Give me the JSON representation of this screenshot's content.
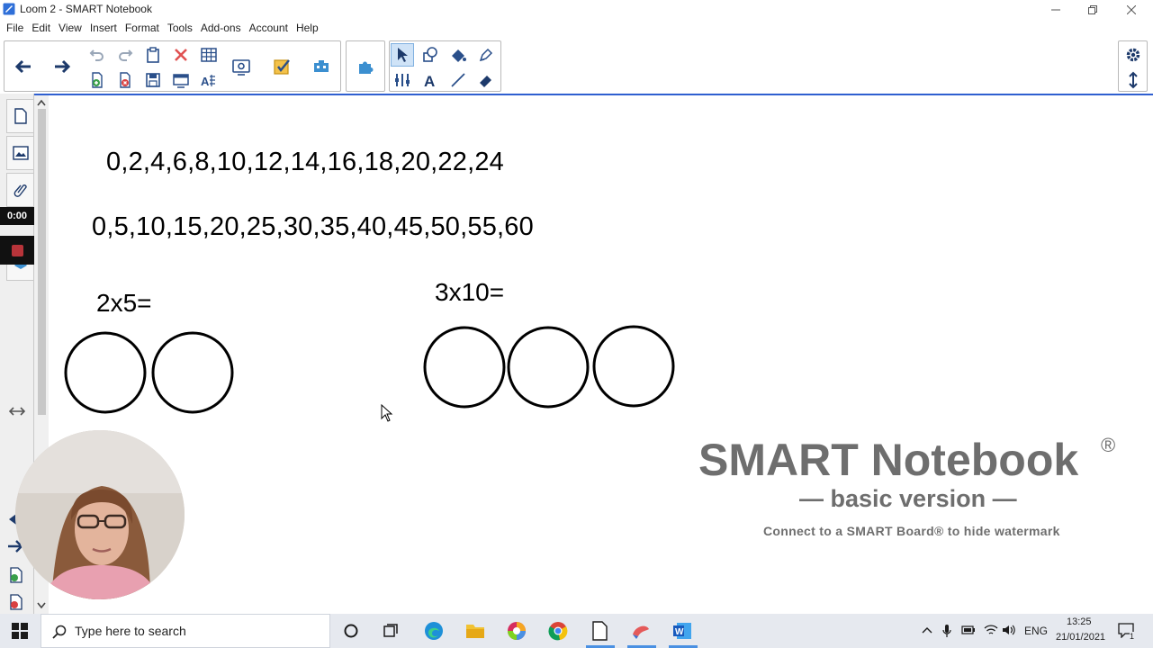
{
  "window": {
    "title": "Loom 2 - SMART Notebook"
  },
  "menu": {
    "items": [
      "File",
      "Edit",
      "View",
      "Insert",
      "Format",
      "Tools",
      "Add-ons",
      "Account",
      "Help"
    ]
  },
  "toolbar": {
    "icons": [
      "back-arrow-icon",
      "forward-arrow-icon",
      "undo-icon",
      "redo-icon",
      "paste-icon",
      "delete-icon",
      "table-icon",
      "add-page-icon",
      "delete-page-icon",
      "save-icon",
      "screen-shade-icon",
      "text-recognition-icon",
      "document-camera-icon",
      "response-icon",
      "addon-icon",
      "puzzle-icon",
      "select-icon",
      "shapes-icon",
      "fill-icon",
      "pen-icon",
      "measurement-icon",
      "text-icon",
      "line-icon",
      "eraser-icon",
      "settings-icon",
      "move-toolbar-icon"
    ]
  },
  "canvas": {
    "sequence_twos": "0,2,4,6,8,10,12,14,16,18,20,22,24",
    "sequence_fives": "0,5,10,15,20,25,30,35,40,45,50,55,60",
    "equation_left": "2x5=",
    "equation_right": "3x10=",
    "circle_groups": [
      {
        "label": "2x5",
        "count": 2
      },
      {
        "label": "3x10",
        "count": 3
      }
    ]
  },
  "watermark": {
    "title": "SMART Notebook",
    "registered": "®",
    "subtitle": "— basic version —",
    "note": "Connect to a SMART Board® to hide watermark"
  },
  "recording": {
    "timer": "0:00"
  },
  "taskbar": {
    "search_placeholder": "Type here to search",
    "language": "ENG",
    "time": "13:25",
    "date": "21/01/2021",
    "notification_count": "1",
    "pinned_apps": [
      "task-view-icon",
      "edge-icon",
      "file-explorer-icon",
      "photos-icon",
      "chrome-icon",
      "document-icon",
      "smart-notebook-icon",
      "word-icon"
    ]
  },
  "colors": {
    "accent_blue": "#2f5fd0",
    "watermark_gray": "#6e6e6e",
    "toolbar_selected": "#cfe3f7"
  }
}
